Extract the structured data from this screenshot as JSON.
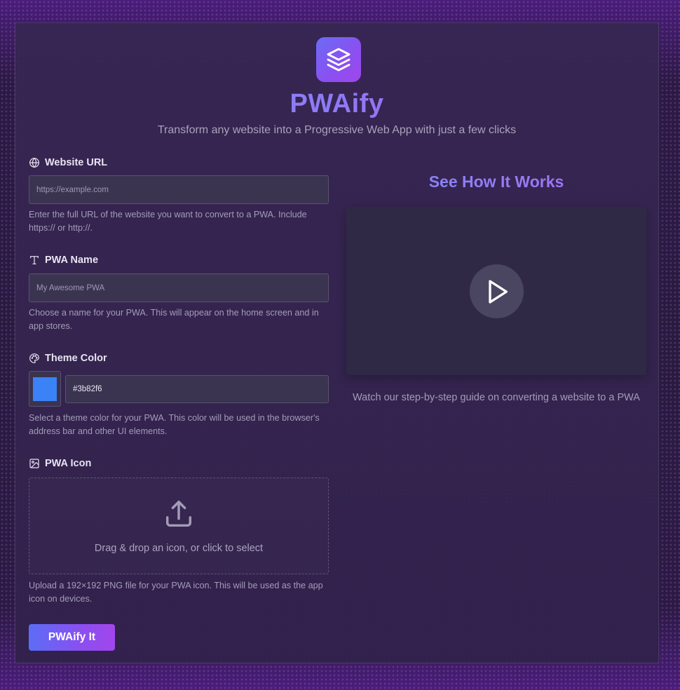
{
  "header": {
    "logo_icon": "layers-icon",
    "title": "PWAify",
    "subtitle": "Transform any website into a Progressive Web App with just a few clicks"
  },
  "form": {
    "url": {
      "label": "Website URL",
      "icon": "globe-icon",
      "placeholder": "https://example.com",
      "help": "Enter the full URL of the website you want to convert to a PWA. Include https:// or http://."
    },
    "name": {
      "label": "PWA Name",
      "icon": "type-icon",
      "placeholder": "My Awesome PWA",
      "help": "Choose a name for your PWA. This will appear on the home screen and in app stores."
    },
    "theme": {
      "label": "Theme Color",
      "icon": "palette-icon",
      "value": "#3b82f6",
      "help": "Select a theme color for your PWA. This color will be used in the browser's address bar and other UI elements."
    },
    "icon": {
      "label": "PWA Icon",
      "icon": "image-icon",
      "drop_text": "Drag & drop an icon, or click to select",
      "help": "Upload a 192×192 PNG file for your PWA icon. This will be used as the app icon on devices."
    },
    "submit_label": "PWAify It"
  },
  "video": {
    "title": "See How It Works",
    "play_icon": "play-icon",
    "caption": "Watch our step-by-step guide on converting a website to a PWA"
  },
  "colors": {
    "accent_start": "#5b6df5",
    "accent_end": "#a146ec",
    "theme_swatch": "#3b82f6"
  }
}
